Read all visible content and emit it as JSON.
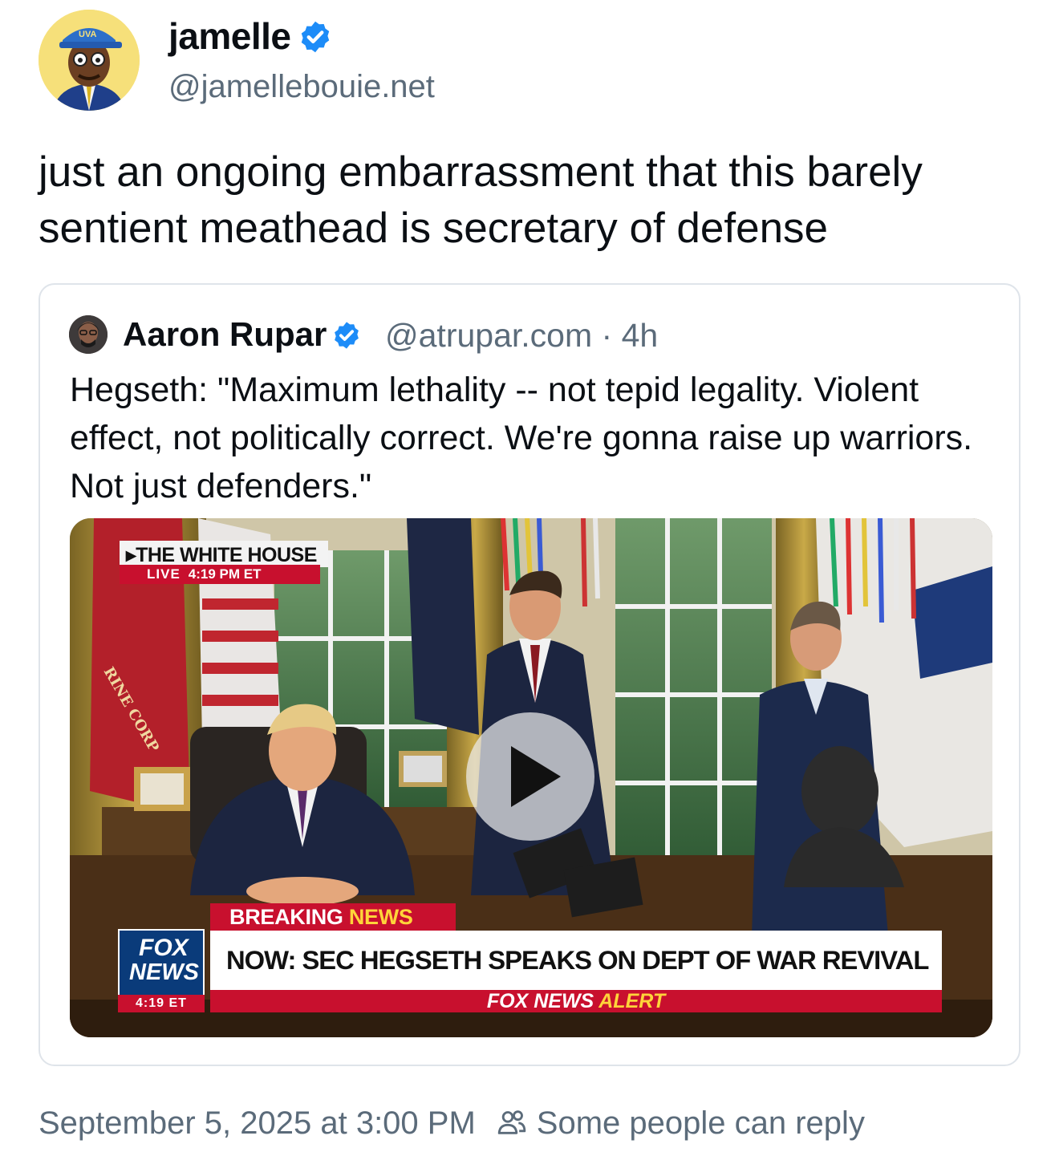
{
  "author": {
    "display_name": "jamelle",
    "handle": "@jamellebouie.net",
    "verified": true,
    "avatar_hat_text": "UVA"
  },
  "post": {
    "text": "just an ongoing embarrassment that this barely sentient meathead is secretary of defense"
  },
  "quote": {
    "display_name": "Aaron Rupar",
    "handle": "@atrupar.com",
    "separator": "·",
    "age": "4h",
    "verified": true,
    "text": "Hegseth: \"Maximum lethality -- not tepid legality. Violent effect, not politically correct. We're gonna raise up warriors. Not just defenders.\"",
    "video": {
      "location_tag": "THE WHITE HOUSE",
      "live_label": "LIVE",
      "live_time": "4:19 PM ET",
      "breaking_word": "BREAKING",
      "news_word": "NEWS",
      "headline": "NOW: SEC HEGSETH SPEAKS ON DEPT OF WAR REVIVAL",
      "alert_prefix": "FOX NEWS",
      "alert_word": "ALERT",
      "logo_fox": "FOX",
      "logo_news": "NEWS",
      "logo_time": "4:19 ET",
      "flag_text": "RINE CORP"
    }
  },
  "footer": {
    "timestamp": "September 5, 2025 at 3:00 PM",
    "reply_setting": "Some people can reply"
  },
  "colors": {
    "verified_blue": "#1d8cf8",
    "secondary_text": "#5b6b7a",
    "fox_red": "#c8102e",
    "fox_blue": "#0a3b7a",
    "fox_yellow": "#ffd43a"
  }
}
